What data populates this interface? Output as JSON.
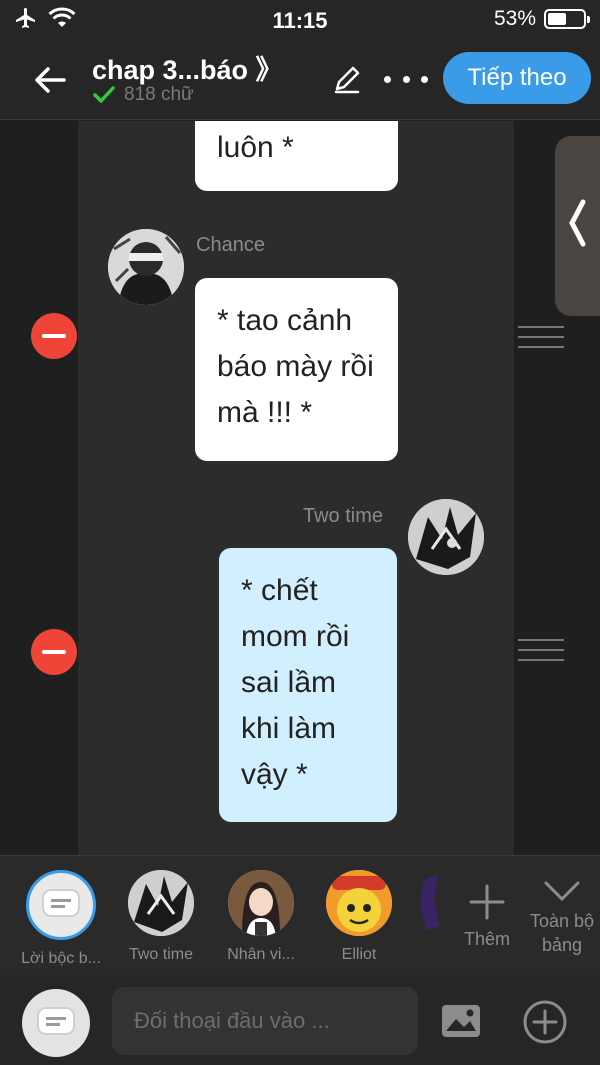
{
  "status_bar": {
    "time": "11:15",
    "battery_text": "53%",
    "battery_level": 0.53,
    "icons": [
      "airplane-icon",
      "wifi-icon",
      "battery-icon"
    ]
  },
  "header": {
    "title": "chap 3...báo 》",
    "word_count": "818 chữ",
    "next_label": "Tiếp theo"
  },
  "messages": [
    {
      "speaker": "",
      "text": "luôn *",
      "side": "left",
      "style": "white",
      "partial": true
    },
    {
      "speaker": "Chance",
      "text": "* tao cảnh báo mày rồi mà !!! *",
      "side": "left",
      "style": "white"
    },
    {
      "speaker": "Two time",
      "text": "* chết mom rồi sai lầm khi làm vậy *",
      "side": "right",
      "style": "blue"
    }
  ],
  "characters": [
    {
      "label": "Lời bộc b...",
      "selected": true
    },
    {
      "label": "Two time",
      "selected": false
    },
    {
      "label": "Nhân vi...",
      "selected": false
    },
    {
      "label": "Elliot",
      "selected": false
    }
  ],
  "add_label": "Thêm",
  "expand_label": "Toàn bộ bảng",
  "input": {
    "placeholder": "Đối thoại đầu vào ..."
  },
  "colors": {
    "accent": "#3a9ce8",
    "remove": "#ef4438",
    "bubble_white": "#ffffff",
    "bubble_blue": "#d2efff",
    "check": "#2ecc40"
  }
}
